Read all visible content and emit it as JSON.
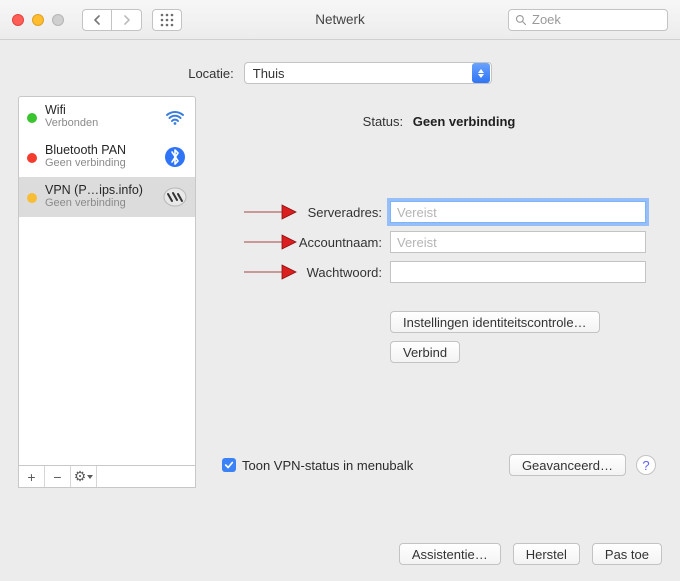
{
  "window": {
    "title": "Netwerk",
    "search_placeholder": "Zoek"
  },
  "location": {
    "label": "Locatie:",
    "value": "Thuis"
  },
  "sidebar": {
    "items": [
      {
        "name": "Wifi",
        "status": "Verbonden",
        "dot": "green",
        "icon": "wifi"
      },
      {
        "name": "Bluetooth PAN",
        "status": "Geen verbinding",
        "dot": "red",
        "icon": "bluetooth"
      },
      {
        "name": "VPN (P…ips.info)",
        "status": "Geen verbinding",
        "dot": "yellow",
        "icon": "vpn"
      }
    ],
    "footer": {
      "add": "+",
      "remove": "−",
      "gear": "⚙"
    }
  },
  "main": {
    "status_label": "Status:",
    "status_value": "Geen verbinding",
    "fields": {
      "server_label": "Serveradres:",
      "server_placeholder": "Vereist",
      "server_value": "",
      "account_label": "Accountnaam:",
      "account_placeholder": "Vereist",
      "account_value": "",
      "password_label": "Wachtwoord:",
      "password_value": ""
    },
    "buttons": {
      "auth_settings": "Instellingen identiteitscontrole…",
      "connect": "Verbind"
    },
    "checkbox": {
      "checked": true,
      "label": "Toon VPN-status in menubalk"
    },
    "advanced": "Geavanceerd…",
    "help": "?"
  },
  "footer": {
    "assist": "Assistentie…",
    "revert": "Herstel",
    "apply": "Pas toe"
  },
  "colors": {
    "accent": "#2f74f6"
  }
}
